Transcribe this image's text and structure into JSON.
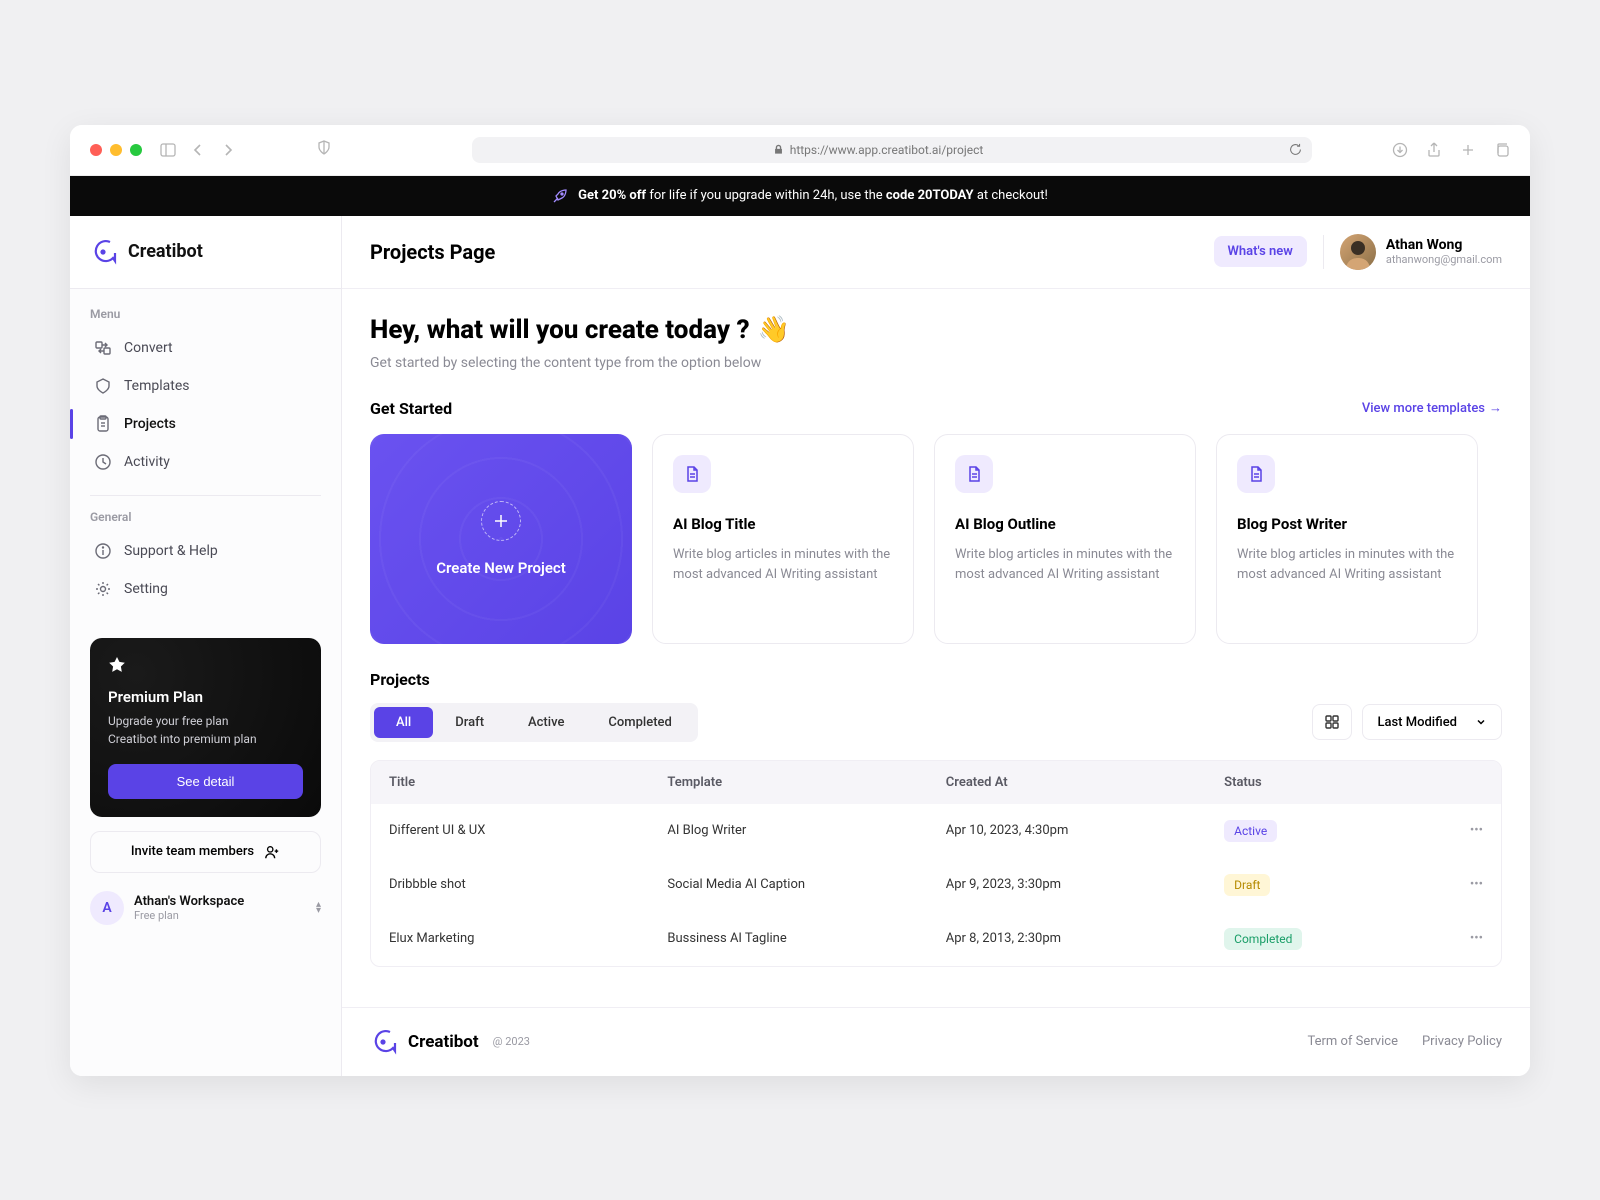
{
  "browser": {
    "url": "https://www.app.creatibot.ai/project"
  },
  "promo": {
    "part1": "Get 20% off",
    "part2": "for life if you upgrade within 24h, use the",
    "code": "code 20TODAY",
    "part3": "at checkout!"
  },
  "brand": {
    "name": "Creatibot",
    "year": "@ 2023"
  },
  "sidebar": {
    "menu_label": "Menu",
    "general_label": "General",
    "items": {
      "convert": "Convert",
      "templates": "Templates",
      "projects": "Projects",
      "activity": "Activity",
      "support": "Support & Help",
      "setting": "Setting"
    },
    "premium": {
      "title": "Premium Plan",
      "line1": "Upgrade your free plan",
      "line2": "Creatibot into premium plan",
      "cta": "See detail"
    },
    "invite_label": "Invite team members",
    "workspace": {
      "initial": "A",
      "name": "Athan's Workspace",
      "plan": "Free plan"
    }
  },
  "topbar": {
    "title": "Projects Page",
    "whats_new": "What's new",
    "user_name": "Athan Wong",
    "user_email": "athanwong@gmail.com"
  },
  "hero": {
    "title": "Hey, what will you create today ?",
    "wave": "👋",
    "sub": "Get started by selecting the content type from the option below"
  },
  "get_started": {
    "label": "Get Started",
    "view_more": "View more templates",
    "create": "Create New Project",
    "cards": [
      {
        "title": "AI Blog Title",
        "desc": "Write blog articles in minutes with the most advanced AI Writing assistant"
      },
      {
        "title": "AI Blog Outline",
        "desc": "Write blog articles in minutes with the most advanced AI Writing assistant"
      },
      {
        "title": "Blog Post Writer",
        "desc": "Write blog articles in minutes with the most advanced AI Writing assistant"
      }
    ]
  },
  "projects": {
    "label": "Projects",
    "tabs": {
      "all": "All",
      "draft": "Draft",
      "active": "Active",
      "completed": "Completed"
    },
    "sort": "Last Modified",
    "columns": {
      "title": "Title",
      "template": "Template",
      "created": "Created At",
      "status": "Status"
    },
    "rows": [
      {
        "title": "Different UI & UX",
        "template": "AI Blog Writer",
        "created": "Apr 10, 2023, 4:30pm",
        "status": "Active",
        "status_class": "badge-active"
      },
      {
        "title": "Dribbble shot",
        "template": "Social Media AI Caption",
        "created": "Apr 9, 2023, 3:30pm",
        "status": "Draft",
        "status_class": "badge-draft"
      },
      {
        "title": "Elux Marketing",
        "template": "Bussiness AI Tagline",
        "created": "Apr 8, 2013, 2:30pm",
        "status": "Completed",
        "status_class": "badge-completed"
      }
    ]
  },
  "footer": {
    "tos": "Term of Service",
    "privacy": "Privacy Policy"
  }
}
